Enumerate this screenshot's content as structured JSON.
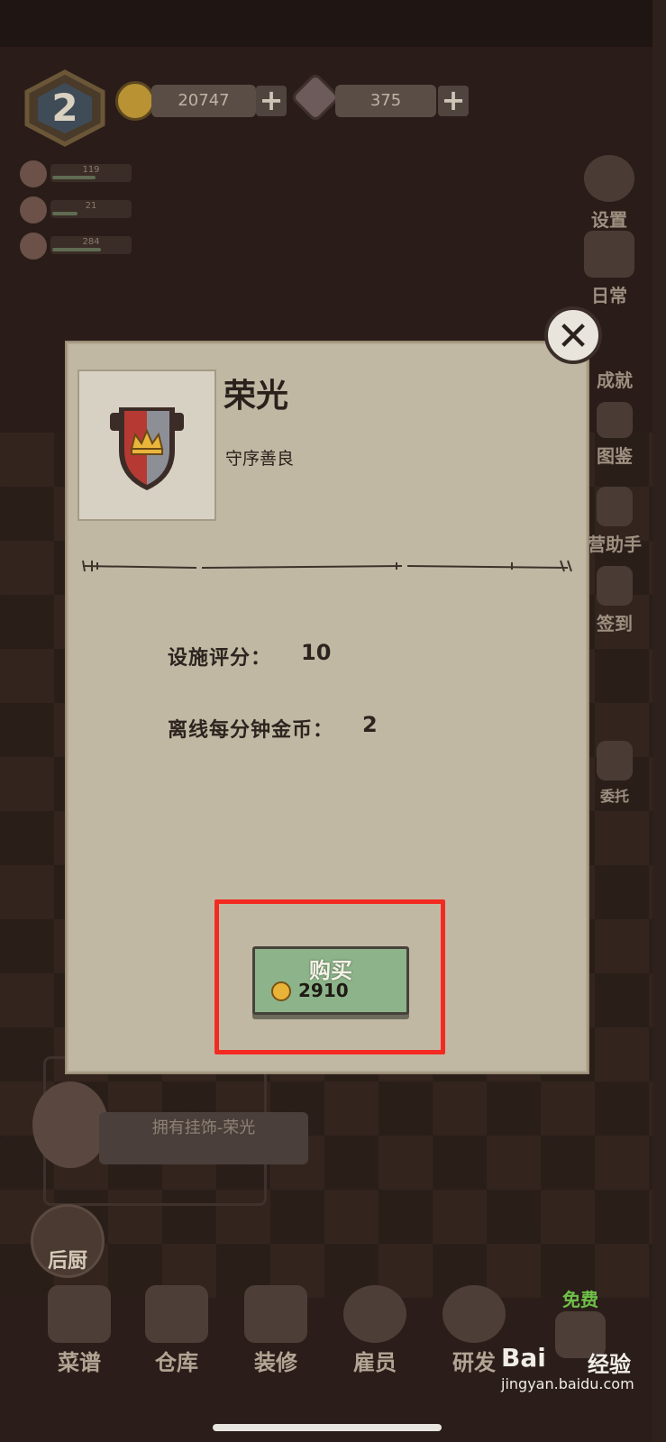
{
  "hud": {
    "level": "2",
    "coins": "20747",
    "gems": "375",
    "stats": [
      {
        "value": "119",
        "fill": 0.55
      },
      {
        "value": "21",
        "fill": 0.3
      },
      {
        "value": "284",
        "fill": 0.6
      }
    ],
    "plus": "+"
  },
  "side_menu": {
    "settings": "设置",
    "daily": "日常",
    "achievements": "成就",
    "codex": "图鉴",
    "assistant": "营助手",
    "checkin": "签到",
    "commission": "委托"
  },
  "modal": {
    "title": "荣光",
    "subtitle": "守序善良",
    "stats": [
      {
        "label": "设施评分：",
        "value": "10"
      },
      {
        "label": "离线每分钟金币：",
        "value": "2"
      }
    ],
    "buy": {
      "label": "购买",
      "price": "2910"
    },
    "close": "✕"
  },
  "notice": {
    "text": "拥有挂饰-荣光"
  },
  "kitchen": {
    "label": "后厨"
  },
  "bottom_nav": {
    "recipes": "菜谱",
    "warehouse": "仓库",
    "decorate": "装修",
    "staff": "雇员",
    "research": "研发",
    "free_badge": "免费"
  },
  "watermark": {
    "logo": "Bai",
    "cn": "经验",
    "url": "jingyan.baidu.com"
  },
  "colors": {
    "panel": "#c1b8a4",
    "buy_button": "#8db38a",
    "highlight": "#f32a22"
  }
}
